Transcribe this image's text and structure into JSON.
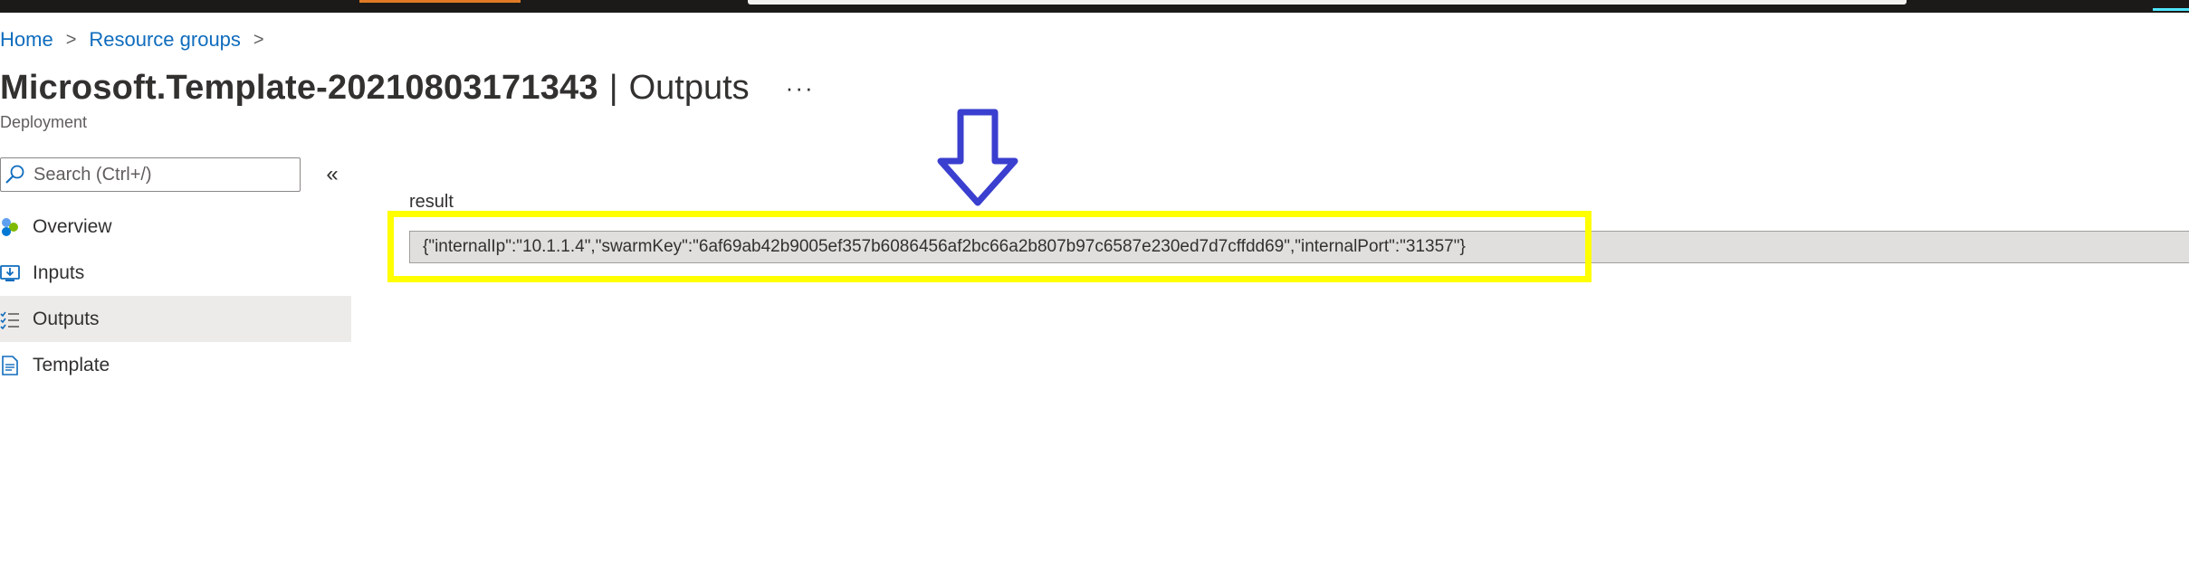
{
  "breadcrumb": {
    "items": [
      "Home",
      "Resource groups"
    ],
    "separator": ">"
  },
  "header": {
    "title": "Microsoft.Template-20210803171343",
    "separator": "|",
    "subtitle": "Outputs",
    "more": "···",
    "resource_type": "Deployment"
  },
  "sidebar": {
    "search": {
      "placeholder": "Search (Ctrl+/)",
      "value": ""
    },
    "collapse": "«",
    "items": [
      {
        "label": "Overview",
        "icon": "overview-icon",
        "selected": false
      },
      {
        "label": "Inputs",
        "icon": "inputs-icon",
        "selected": false
      },
      {
        "label": "Outputs",
        "icon": "outputs-icon",
        "selected": true
      },
      {
        "label": "Template",
        "icon": "template-icon",
        "selected": false
      }
    ]
  },
  "main": {
    "result_label": "result",
    "result_value": "{\"internalIp\":\"10.1.1.4\",\"swarmKey\":\"6af69ab42b9005ef357b6086456af2bc66a2b807b97c6587e230ed7d7cffdd69\",\"internalPort\":\"31357\"}"
  },
  "colors": {
    "link": "#0f6cbd",
    "highlight": "#ffff00",
    "arrow": "#3a3fcf",
    "selected_nav": "#edebe9",
    "top_bar": "#1b1a19"
  }
}
